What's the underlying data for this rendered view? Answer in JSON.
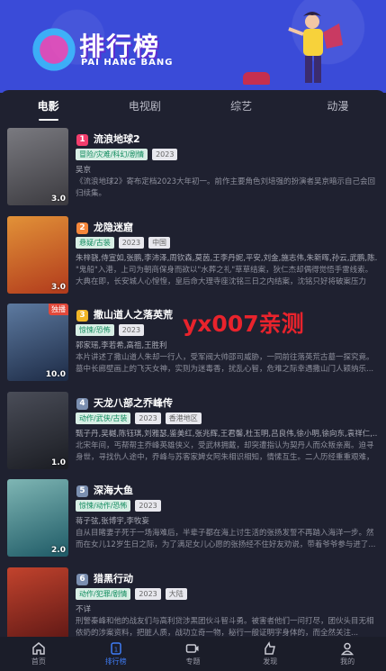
{
  "banner": {
    "title": "排行榜",
    "subtitle": "PAI HANG BANG"
  },
  "tabs": [
    {
      "label": "电影",
      "active": true
    },
    {
      "label": "电视剧",
      "active": false
    },
    {
      "label": "综艺",
      "active": false
    },
    {
      "label": "动漫",
      "active": false
    }
  ],
  "watermark": "yx007亲测",
  "items": [
    {
      "rank": "1",
      "rank_color": "#f23d6c",
      "title": "流浪地球2",
      "chips": [
        "冒险/灾难/科幻/剧情",
        "2023"
      ],
      "cast": "吴京",
      "desc": "《流浪地球2》寄布定档2023大年初一。前作主要角色刘培强的扮演者吴京暗示自己会回归续集。",
      "score": "3.0",
      "tag": "",
      "poster_colors": [
        "#3b3a3f",
        "#7a7a80"
      ]
    },
    {
      "rank": "2",
      "rank_color": "#f5863a",
      "title": "龙隐迷窟",
      "chips": [
        "悬疑/古装",
        "2023",
        "中国"
      ],
      "cast": "朱梓骁,侍宣如,张鹏,李沛泽,周钦森,莫茵,王李丹妮,平安,刘金,施志伟,朱新晖,孙云,武鹏,陈...",
      "desc": "\"鬼船\"入港，上司为朝商保身而欲以\"水葬之礼\"草草结案，狄仁杰却偶得觉悟手雷线索。大典在即，长安城人心惶惶，皇后命大理寺座沈铭三日之内结案，沈铭只好将破案压力给...",
      "score": "3.0",
      "tag": "",
      "poster_colors": [
        "#b13a1c",
        "#e29238"
      ]
    },
    {
      "rank": "3",
      "rank_color": "#f1b627",
      "title": "撒山道人之落英荒",
      "chips": [
        "惊悚/恐怖",
        "2023"
      ],
      "cast": "郭家瑶,李若希,高祖,王胜利",
      "desc": "本片讲述了撒山道人朱却一行人，受军阀大帅邵司威胁，一同前往落英荒古墓一探究竟。墓中长廊壁画上的飞天女神，实则为迷毒香，扰乱心智，危难之际幸遇撒山门人颖纳乐...",
      "score": "10.0",
      "tag": "独播",
      "poster_colors": [
        "#1d2b46",
        "#5d7aa0"
      ]
    },
    {
      "rank": "4",
      "rank_color": "#7b8fb0",
      "title": "天龙八部之乔峰传",
      "chips": [
        "动作/武侠/古装",
        "2023",
        "香港地区"
      ],
      "cast": "甄子丹,吴樾,陈钰琪,刘雅瑟,鉴美红,张兆辉,王君馨,杜玉明,吕良伟,徐小明,徐向东,袁祥仁,...",
      "desc": "北宋年间，丐帮帮主乔峰英雄侠义，受武林拥戴，却突遭指认为契丹人而众叛亲离。迫寻身世，寻找仇人途中，乔峰与苏客家婢女阿朱相识相知，情愫互生。二人历经重重艰难，正...",
      "score": "1.0",
      "tag": "",
      "poster_colors": [
        "#1a1c22",
        "#4a4d58"
      ]
    },
    {
      "rank": "5",
      "rank_color": "#7b8fb0",
      "title": "深海大鱼",
      "chips": [
        "惊悚/动作/恐怖",
        "2023"
      ],
      "cast": "蒋子弦,张博宇,李牧妄",
      "desc": "自从目睹妻子死于一场海难后，半辈子都在海上讨生活的张扬发誓不再踏入海洋一步。然而在女儿12岁生日之际，为了满足女儿心愿的张扬经不住好友劝说，带着爷爷参与进了...",
      "score": "2.0",
      "tag": "",
      "poster_colors": [
        "#1e5a66",
        "#7fb6b4"
      ]
    },
    {
      "rank": "6",
      "rank_color": "#7b8fb0",
      "title": "猎黑行动",
      "chips": [
        "动作/犯罪/剧情",
        "2023",
        "大陆"
      ],
      "cast": "不详",
      "desc": "刑警秦峰和他的战友们与高利贷涉黑团伙斗智斗勇。被害者他们一问打尽，团伙头目无相依奶的涉案资料，把脏人质，战功立奇一物，秘行一般证明字身体的，而全然关注...",
      "score": "",
      "tag": "",
      "poster_colors": [
        "#5a1614",
        "#c2432d"
      ]
    }
  ],
  "tabbar": [
    {
      "label": "首页",
      "icon": "home-icon",
      "active": false
    },
    {
      "label": "排行榜",
      "icon": "ranking-icon",
      "active": true
    },
    {
      "label": "专题",
      "icon": "video-icon",
      "active": false
    },
    {
      "label": "发现",
      "icon": "discover-icon",
      "active": false
    },
    {
      "label": "我的",
      "icon": "profile-icon",
      "active": false
    }
  ],
  "colors": {
    "accent": "#3f7cf5",
    "background": "#1f2130",
    "banner": "#3a4bd8"
  }
}
